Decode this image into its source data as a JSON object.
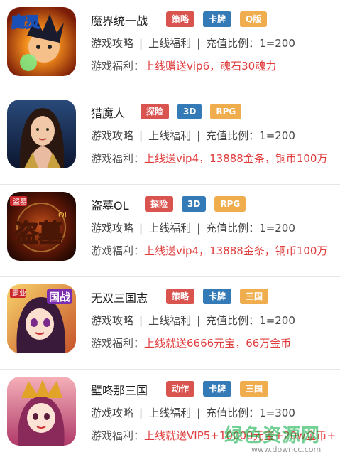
{
  "colors": {
    "tag_red": "#d9534f",
    "tag_blue": "#337ab7",
    "tag_orange": "#f0ad4e",
    "bonus_red": "#e03c3c"
  },
  "games": [
    {
      "title": "魔界统一战",
      "tags": [
        {
          "label": "策略",
          "color": "red"
        },
        {
          "label": "卡牌",
          "color": "blue"
        },
        {
          "label": "Q版",
          "color": "orange"
        }
      ],
      "guide_label": "游戏攻略",
      "welfare_label": "上线福利",
      "recharge": "充值比例：1=200",
      "bonus_label": "游戏福利：",
      "bonus": "上线赠送vip6，魂石30魂力",
      "icon_name": "mojie-game-icon",
      "icon_text": "魔灵"
    },
    {
      "title": "猎魔人",
      "tags": [
        {
          "label": "探险",
          "color": "red"
        },
        {
          "label": "3D",
          "color": "blue"
        },
        {
          "label": "RPG",
          "color": "orange"
        }
      ],
      "guide_label": "游戏攻略",
      "welfare_label": "上线福利",
      "recharge": "充值比例：1=200",
      "bonus_label": "游戏福利：",
      "bonus": "上线送vip4，13888金条，铜币100万",
      "icon_name": "liemoren-game-icon",
      "icon_text": ""
    },
    {
      "title": "盗墓OL",
      "tags": [
        {
          "label": "探险",
          "color": "red"
        },
        {
          "label": "3D",
          "color": "blue"
        },
        {
          "label": "RPG",
          "color": "orange"
        }
      ],
      "guide_label": "游戏攻略",
      "welfare_label": "上线福利",
      "recharge": "充值比例：1=200",
      "bonus_label": "游戏福利：",
      "bonus": "上线送vip4，13888金条，铜币100万",
      "icon_name": "daomu-game-icon",
      "icon_text": "盗墓"
    },
    {
      "title": "无双三国志",
      "tags": [
        {
          "label": "策略",
          "color": "red"
        },
        {
          "label": "卡牌",
          "color": "blue"
        },
        {
          "label": "三国",
          "color": "orange"
        }
      ],
      "guide_label": "游戏攻略",
      "welfare_label": "上线福利",
      "recharge": "充值比例：1=200",
      "bonus_label": "游戏福利：",
      "bonus": "上线就送6666元宝，66万金币",
      "icon_name": "wushuang-game-icon",
      "icon_text": "国战"
    },
    {
      "title": "壁咚那三国",
      "tags": [
        {
          "label": "动作",
          "color": "red"
        },
        {
          "label": "卡牌",
          "color": "blue"
        },
        {
          "label": "三国",
          "color": "orange"
        }
      ],
      "guide_label": "游戏攻略",
      "welfare_label": "上线福利",
      "recharge": "充值比例：1=300",
      "bonus_label": "游戏福利：",
      "bonus": "上线就送VIP5+10000元宝+20w金币+",
      "icon_name": "bidong-game-icon",
      "icon_text": ""
    }
  ],
  "watermark": {
    "text": "绿色资源网",
    "url": "www.downcc.com"
  }
}
